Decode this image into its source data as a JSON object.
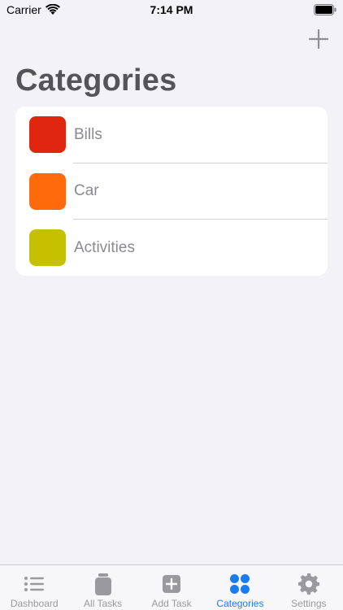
{
  "status_bar": {
    "carrier": "Carrier",
    "time": "7:14 PM"
  },
  "header": {
    "title": "Categories",
    "add_icon": "plus-icon"
  },
  "categories": [
    {
      "label": "Bills",
      "color": "#e0260f"
    },
    {
      "label": "Car",
      "color": "#ff6a0a"
    },
    {
      "label": "Activities",
      "color": "#c6c100"
    }
  ],
  "tabs": [
    {
      "label": "Dashboard",
      "icon": "list-icon",
      "active": false
    },
    {
      "label": "All Tasks",
      "icon": "jar-icon",
      "active": false
    },
    {
      "label": "Add Task",
      "icon": "plus-square-icon",
      "active": false
    },
    {
      "label": "Categories",
      "icon": "grid-dots-icon",
      "active": true
    },
    {
      "label": "Settings",
      "icon": "gear-icon",
      "active": false
    }
  ],
  "colors": {
    "accent": "#1a7cf2",
    "inactive": "#9a9a9e"
  }
}
